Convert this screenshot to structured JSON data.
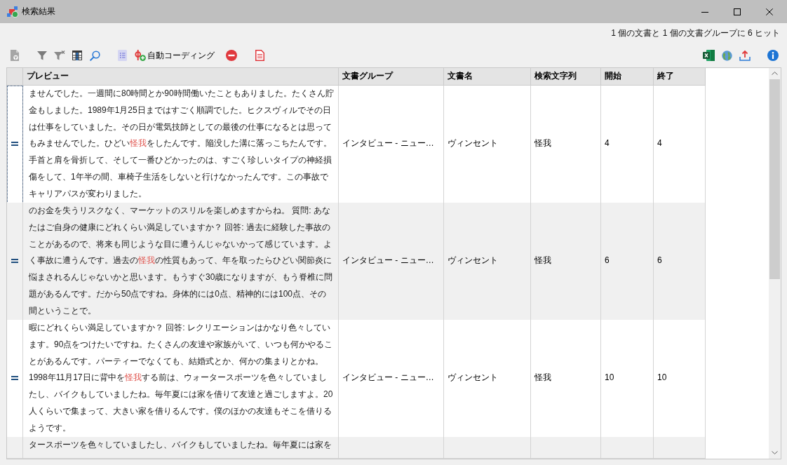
{
  "window": {
    "title": "検索結果"
  },
  "hit_summary": "1 個の文書と 1 個の文書グループに 6 ヒット",
  "toolbar": {
    "auto_coding_label": "自動コーディング"
  },
  "table": {
    "columns": [
      "プレビュー",
      "文書グループ",
      "文書名",
      "検索文字列",
      "開始",
      "終了"
    ],
    "rows": [
      {
        "focused": true,
        "cut_off": false,
        "preview": [
          {
            "text": "ませんでした。一週間に80時間とか90時間働いたこともありました。たくさん貯金もしました。1989年1月25日まではすごく順調でした。ヒクスヴィルでその日は仕事をしていました。その日が電気技師としての最後の仕事になるとは思ってもみませんでした。ひどい",
            "hit": false
          },
          {
            "text": "怪我",
            "hit": true
          },
          {
            "text": "をしたんです。陥没した溝に落っこちたんです。手首と肩を骨折して、そして一番ひどかったのは、すごく珍しいタイプの神経損傷をして、1年半の間、車椅子生活をしないと行けなかったんです。この事故でキャリアパスが変わりました。",
            "hit": false
          }
        ],
        "document_group": "インタビュー - ニュー…",
        "document": "ヴィンセント",
        "search_string": "怪我",
        "start": "4",
        "end": "4"
      },
      {
        "focused": false,
        "cut_off": false,
        "preview": [
          {
            "text": "のお金を失うリスクなく、マーケットのスリルを楽しめますからね。 質問: あなたはご自身の健康にどれくらい満足していますか？ 回答: 過去に経験した事故のことがあるので、将来も同じような目に遭うんじゃないかって感じています。よく事故に遭うんです。過去の",
            "hit": false
          },
          {
            "text": "怪我",
            "hit": true
          },
          {
            "text": "の性質もあって、年を取ったらひどい関節炎に悩まされるんじゃないかと思います。もうすぐ30歳になりますが、もう脊椎に問題があるんです。だから50点ですね。身体的には0点、精神的には100点、その間ということで。",
            "hit": false
          }
        ],
        "document_group": "インタビュー - ニュー…",
        "document": "ヴィンセント",
        "search_string": "怪我",
        "start": "6",
        "end": "6"
      },
      {
        "focused": false,
        "cut_off": false,
        "preview": [
          {
            "text": "暇にどれくらい満足していますか？ 回答: レクリエーションはかなり色々しています。90点をつけたいですね。たくさんの友達や家族がいて、いつも何かやることがあるんです。パーティーでなくても、結婚式とか、何かの集まりとかね。1998年11月17日に背中を",
            "hit": false
          },
          {
            "text": "怪我",
            "hit": true
          },
          {
            "text": "する前は、ウォータースポーツを色々していましたし、バイクもしていましたね。毎年夏には家を借りて友達と過ごしますよ。20人くらいで集まって、大きい家を借りるんです。僕のほかの友達もそこを借りるようです。",
            "hit": false
          }
        ],
        "document_group": "インタビュー - ニュー…",
        "document": "ヴィンセント",
        "search_string": "怪我",
        "start": "10",
        "end": "10"
      },
      {
        "focused": false,
        "cut_off": true,
        "preview": [
          {
            "text": "タースポーツを色々していましたし、バイクもしていましたね。毎年夏には家を",
            "hit": false
          }
        ]
      }
    ]
  }
}
